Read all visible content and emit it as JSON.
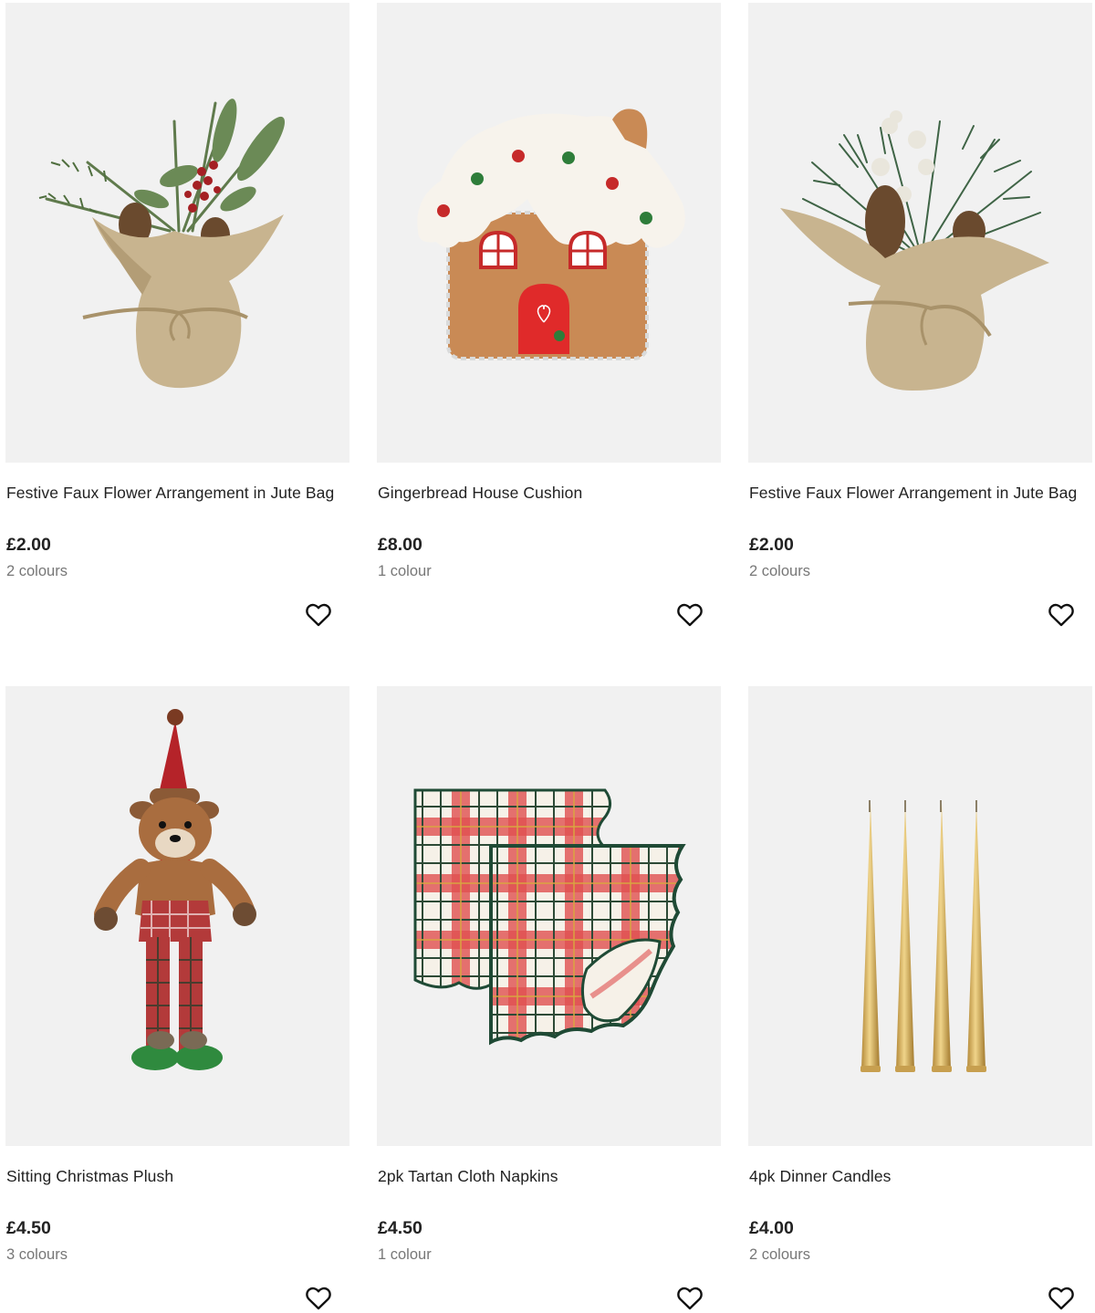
{
  "products": [
    {
      "title": "Festive Faux Flower Arrangement in Jute Bag",
      "price": "£2.00",
      "colours": "2 colours",
      "image_icon": "jute-bag-arrangement-red-berries"
    },
    {
      "title": "Gingerbread House Cushion",
      "price": "£8.00",
      "colours": "1 colour",
      "image_icon": "gingerbread-house-cushion"
    },
    {
      "title": "Festive Faux Flower Arrangement in Jute Bag",
      "price": "£2.00",
      "colours": "2 colours",
      "image_icon": "jute-bag-arrangement-pine"
    },
    {
      "title": "Sitting Christmas Plush",
      "price": "£4.50",
      "colours": "3 colours",
      "image_icon": "reindeer-plush"
    },
    {
      "title": "2pk Tartan Cloth Napkins",
      "price": "£4.50",
      "colours": "1 colour",
      "image_icon": "tartan-napkins"
    },
    {
      "title": "4pk Dinner Candles",
      "price": "£4.00",
      "colours": "2 colours",
      "image_icon": "gold-dinner-candles"
    }
  ],
  "wishlist_icon": "heart-outline-icon",
  "colors": {
    "image_background": "#f1f1f1",
    "price_text": "#222222",
    "colours_text": "#777777"
  }
}
